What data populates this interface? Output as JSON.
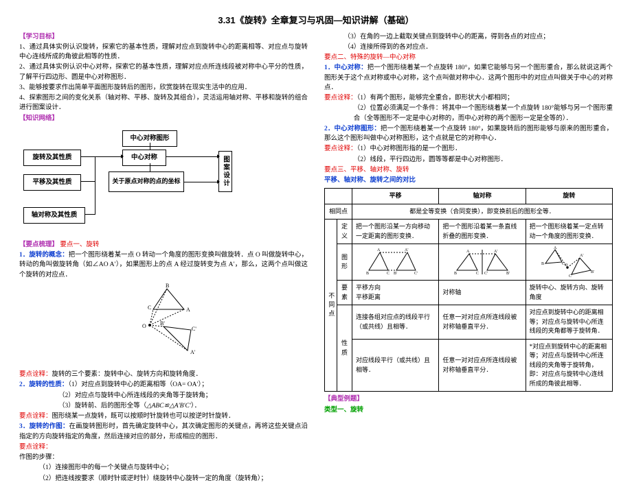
{
  "title": "3.31《旋转》全章复习与巩固—知识讲解（基础）",
  "left": {
    "sec_goals_hdr": "【学习目标】",
    "goal1": "1、通过具体实例认识旋转，探索它的基本性质，理解对应点到旋转中心的距离相等、对应点与旋转中心连线所成的角彼此相等的性质．",
    "goal2": "2、通过具体实例认识中心对称，探索它的基本性质，理解对应点所连线段被对称中心平分的性质，了解平行四边形、圆是中心对称图形．",
    "goal3": "3、能够按要求作出简单平面图形旋转后的图形，欣赏旋转在现实生活中的应用．",
    "goal4": "4、探索图形之间的变化关系（轴对称、平移、旋转及其组合），灵活运用轴对称、平移和旋转的组合进行图案设计．",
    "sec_net_hdr": "【知识网络】",
    "box_center_sym_fig": "中心对称图形",
    "box_rotate": "旋转及其性质",
    "box_center_sym": "中心对称",
    "box_translate": "平移及其性质",
    "box_origin_coord": "关于原点对称的点的坐标",
    "box_design": "图案设计",
    "box_axial": "轴对称及其性质",
    "sec_points_hdr": "【要点梳理】",
    "pt1_hdr": "要点一、旋转",
    "rot_concept_hdr": "1．旋转的概念：",
    "rot_concept": "把一个图形绕着某一点 O 转动一个角度的图形变换叫做旋转．点 O 叫做旋转中心，转动的角叫做旋转角（如∠AO A′），如果图形上的点 A 经过旋转变为点 A′，那么，这两个点叫做这个旋转的对应点．",
    "tip_hdr": "要点诠释：",
    "tip_rot3": "旋转的三个要素：旋转中心、旋转方向和旋转角度．",
    "rot_prop_hdr": "2．旋转的性质：",
    "prop1": "（1）对应点到旋转中心的距离相等（OA= OA′）；",
    "prop2": "（2）对应点与旋转中心所连线段的夹角等于旋转角；",
    "prop3_a": "（3）旋转前、后的图形全等（",
    "prop3_b": "△ABC≌△A'B'C'",
    "prop3_c": "）．",
    "tip_dir": "图形绕某一点旋转，既可以按顺时针旋转也可以按逆时针旋转．",
    "rot_draw_hdr": "3．旋转的作图：",
    "rot_draw": "在画旋转图形时，首先确定旋转中心，其次确定图形的关键点，再将这些关键点沿指定的方向旋转指定的角度，然后连接对应的部分，形成相应的图形．",
    "steps_hdr": "作图的步骤：",
    "step1": "（1）连接图形中的每一个关键点与旋转中心；",
    "step2": "（2）把连线按要求（顺时针或逆时针）绕旋转中心旋转一定的角度（旋转角）；"
  },
  "right": {
    "step3": "（3）在角的一边上截取关键点到旋转中心的距离，得到各点的对应点；",
    "step4": "（4）连接所得到的各对应点．",
    "pt2_hdr": "要点二、特殊的旋转—中心对称",
    "cs_hdr": "1．中心对称：",
    "cs_text": "把一个图形绕着某一个点旋转 180°，如果它能够与另一个图形重合，那么就说这两个图形关于这个点对称或中心对称，这个点叫做对称中心．这两个图形中的对应点叫做关于中心的对称点．",
    "tip_hdr2": "要点诠释：",
    "cs_tip1": "（1）有两个图形，能够完全重合，即形状大小都相同；",
    "cs_tip2": "（2）位置必须满足一个条件：将其中一个图形绕着某一个点旋转 180°能够与另一个图形重合（全等图形不一定是中心对称的，而中心对称的两个图形一定是全等的）．",
    "csf_hdr": "2．中心对称图形：",
    "csf_text": "把一个图形绕着某一个点旋转 180°，如果旋转后的图形能够与原来的图形重合，那么这个图形叫做中心对称图形，这个点就是它的对称中心．",
    "tip_hdr3": "要点诠释：",
    "csf_tip1": "（1）中心对称图形指的是一个图形．",
    "csf_tip2": "（2）线段，平行四边形，圆等等都是中心对称图形．",
    "pt3_hdr": "要点三、平移、轴对称、旋转",
    "cmp_hdr": "平移、轴对称、旋转之间的对比",
    "tbl": {
      "h_translate": "平移",
      "h_axial": "轴对称",
      "h_rotate": "旋转",
      "same_hdr": "相同点",
      "same": "都是全等变换（合同变换），即变换前后的图形全等．",
      "diff_hdr": "不同点",
      "r_def": "定义",
      "c1_def": "把一个图形沿某一方向移动一定距离的图形变换．",
      "c2_def": "把一个图形沿着某一条直线折叠的图形变换．",
      "c3_def": "把一个图形绕着某一定点转动一个角度的图形变换．",
      "r_fig": "图形",
      "r_elem": "要素",
      "c1_elem": "平移方向\n平移距离",
      "c2_elem": "对称轴",
      "c3_elem": "旋转中心、旋转方向、旋转角度",
      "r_prop": "性质",
      "c1_p1": "连接各组对应点的线段平行（或共线）且相等．",
      "c2_p1": "任意一对对应点所连线段被对称轴垂直平分．",
      "c3_p1": "对应点到旋转中心的距离相等；对应点与旋转中心所连线段的夹角都等于旋转角．",
      "c1_p2": "对应线段平行（或共线）且相等．",
      "c2_p2": "任意一对对应点所连线段被对称轴垂直平分．",
      "c3_p2": "*对应点到旋转中心的距离相等；对应点与旋转中心所连线段的夹角等于旋转角，即：对应点与旋转中心连线所成的角彼此相等．"
    },
    "sec_ex_hdr": "【典型例题】",
    "ex_type1": "类型一、旋转"
  }
}
